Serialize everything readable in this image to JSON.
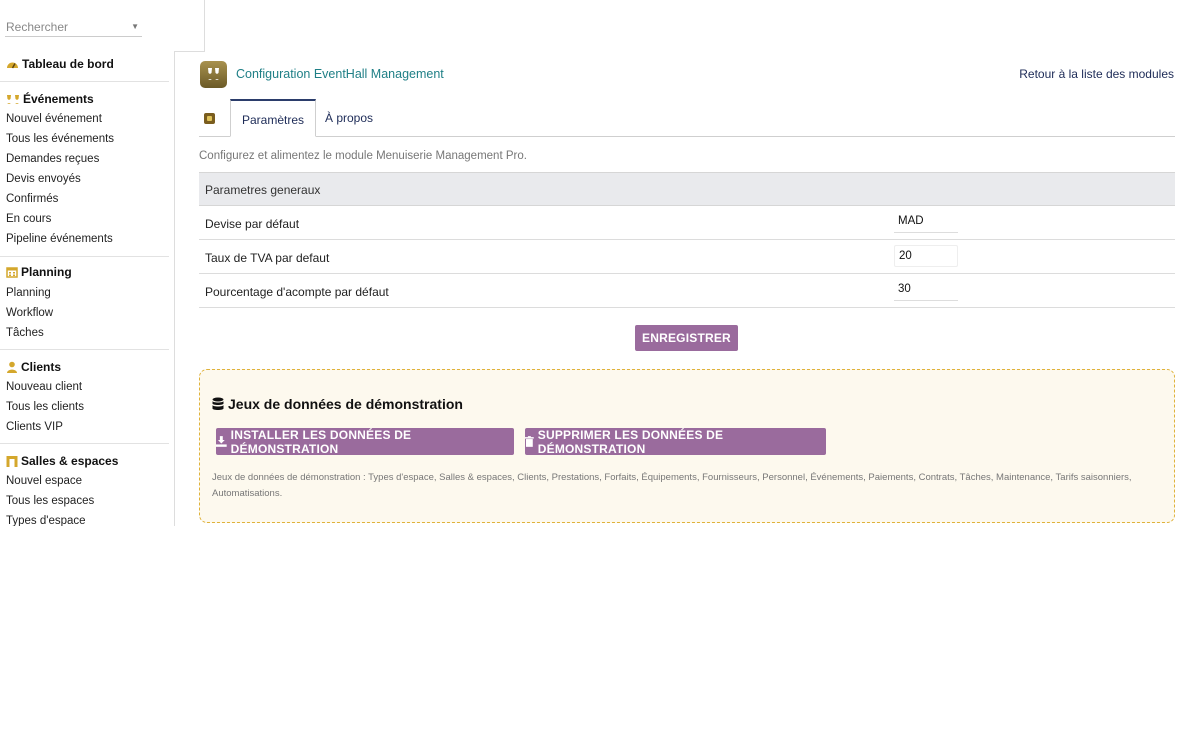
{
  "search": {
    "placeholder": "Rechercher"
  },
  "sidebar": {
    "dashboard": "Tableau de bord",
    "events": {
      "title": "Événements",
      "items": [
        "Nouvel événement",
        "Tous les événements",
        "Demandes reçues",
        "Devis envoyés",
        "Confirmés",
        "En cours",
        "Pipeline événements"
      ]
    },
    "planning": {
      "title": "Planning",
      "items": [
        "Planning",
        "Workflow",
        "Tâches"
      ]
    },
    "clients": {
      "title": "Clients",
      "items": [
        "Nouveau client",
        "Tous les clients",
        "Clients VIP"
      ]
    },
    "rooms": {
      "title": "Salles & espaces",
      "items": [
        "Nouvel espace",
        "Tous les espaces",
        "Types d'espace"
      ]
    }
  },
  "header": {
    "title": "Configuration EventHall Management",
    "back_link": "Retour à la liste des modules"
  },
  "tabs": [
    "Paramètres",
    "À propos"
  ],
  "intro": "Configurez et alimentez le module Menuiserie Management Pro.",
  "settings": {
    "section_title": "Parametres generaux",
    "rows": [
      {
        "label": "Devise par défaut",
        "value": "MAD"
      },
      {
        "label": "Taux de TVA par defaut",
        "value": "20"
      },
      {
        "label": "Pourcentage d'acompte par défaut",
        "value": "30"
      }
    ],
    "save_label": "ENREGISTRER"
  },
  "demo": {
    "title": "Jeux de données de démonstration",
    "install_label": "INSTALLER LES DONNÉES DE DÉMONSTRATION",
    "delete_label": "SUPPRIMER LES DONNÉES DE DÉMONSTRATION",
    "description": "Jeux de données de démonstration : Types d'espace, Salles & espaces, Clients, Prestations, Forfaits, Équipements, Fournisseurs, Personnel, Événements, Paiements, Contrats, Tâches, Maintenance, Tarifs saisonniers, Automatisations."
  },
  "colors": {
    "accent_button": "#9a6b9d",
    "title_link": "#1f7f86",
    "icon_gold": "#d4a72c",
    "demo_border": "#e0b23a"
  },
  "icons": {
    "dashboard": "dashboard-gauge-icon",
    "events": "event-glasses-icon",
    "planning": "calendar-icon",
    "clients": "user-icon",
    "rooms": "building-icon",
    "logo": "champagne-glasses-icon",
    "demo": "database-icon",
    "install": "download-icon",
    "delete": "trash-icon"
  }
}
